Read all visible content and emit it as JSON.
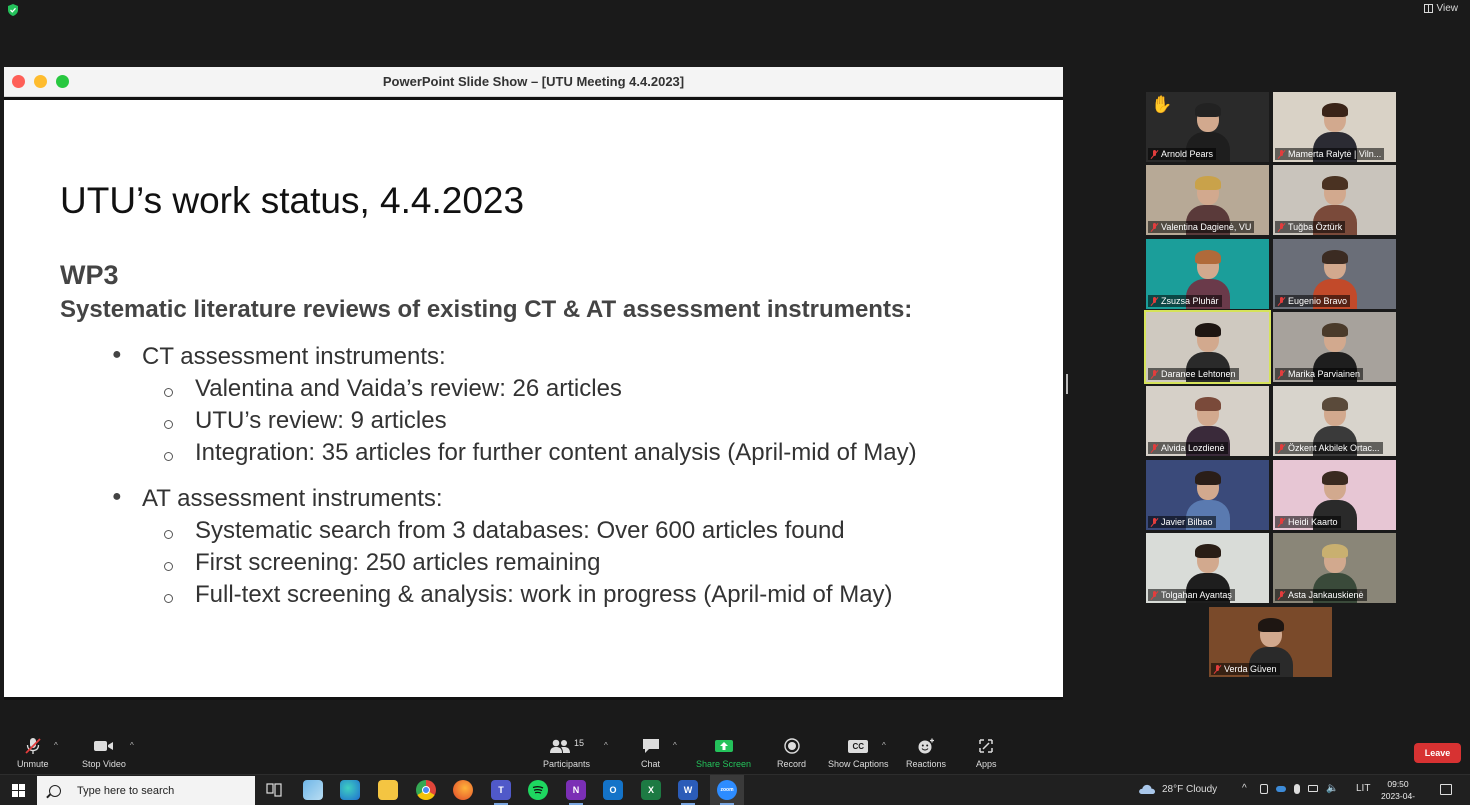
{
  "top": {
    "view_label": "View"
  },
  "window": {
    "title": "PowerPoint Slide Show – [UTU Meeting 4.4.2023]"
  },
  "slide": {
    "title": "UTU’s work status, 4.4.2023",
    "wp": "WP3",
    "subtitle": "Systematic literature reviews of existing CT & AT assessment instruments:",
    "bullets": [
      {
        "text": "CT assessment instruments:",
        "sub": [
          "Valentina and Vaida’s review: 26 articles",
          "UTU’s review: 9 articles",
          "Integration: 35 articles for further content analysis (April-mid of May)"
        ]
      },
      {
        "text": "AT assessment instruments:",
        "sub": [
          "Systematic search from 3 databases: Over 600 articles found",
          "First screening: 250 articles remaining",
          "Full-text screening & analysis: work in progress (April-mid of May)"
        ]
      }
    ]
  },
  "participants": [
    {
      "name": "Arnold Pears",
      "bg": "#2a2a2a",
      "hair": "#222",
      "body": "#1e1e1e",
      "hand": "✋"
    },
    {
      "name": "Mamerta Ralytė | Viln...",
      "bg": "#d9d2c6",
      "hair": "#3a2418",
      "body": "#2b2b33"
    },
    {
      "name": "Valentina Dagienė, VU",
      "bg": "#b7a996",
      "hair": "#c9a24a",
      "body": "#5a3a3a"
    },
    {
      "name": "Tuğba Öztürk",
      "bg": "#c9c4bc",
      "hair": "#4a3222",
      "body": "#7a4a3a"
    },
    {
      "name": "Zsuzsa Pluhár",
      "bg": "#1b9e9a",
      "hair": "#b06a3a",
      "body": "#6a3a4a"
    },
    {
      "name": "Eugenio Bravo",
      "bg": "#6a6e78",
      "hair": "#3b2b22",
      "body": "#c24a2a"
    },
    {
      "name": "Daranee Lehtonen",
      "bg": "#cfc9c0",
      "hair": "#1e1612",
      "body": "#2a2a2a",
      "active": true
    },
    {
      "name": "Marika Parviainen",
      "bg": "#a7a29c",
      "hair": "#4a3a2a",
      "body": "#1e1e1e"
    },
    {
      "name": "Alvida Lozdienė",
      "bg": "#d6d0c8",
      "hair": "#7a4a3a",
      "body": "#3a2a3a"
    },
    {
      "name": "Özkent Akbilek Ortac...",
      "bg": "#d8d4cc",
      "hair": "#5a4a3a",
      "body": "#3a3a3a"
    },
    {
      "name": "Javier Bilbao",
      "bg": "#3a4a7a",
      "hair": "#2a1e18",
      "body": "#5a7ab0"
    },
    {
      "name": "Heidi Kaarto",
      "bg": "#e7c6d4",
      "hair": "#3a2a20",
      "body": "#2a2a2a"
    },
    {
      "name": "Tolgahan Ayantaş",
      "bg": "#d9dcd8",
      "hair": "#2a1e16",
      "body": "#1e1e1e"
    },
    {
      "name": "Asta Jankauskienė",
      "bg": "#8a8678",
      "hair": "#c9b070",
      "body": "#3a4a3a"
    },
    {
      "name": "Verda Güven",
      "bg": "#7a4a2a",
      "hair": "#1e1612",
      "body": "#2a2a2a"
    }
  ],
  "toolbar": {
    "unmute": "Unmute",
    "stop_video": "Stop Video",
    "participants": "Participants",
    "participants_count": "15",
    "chat": "Chat",
    "share_screen": "Share Screen",
    "record": "Record",
    "show_captions": "Show Captions",
    "captions_icon": "CC",
    "reactions": "Reactions",
    "apps": "Apps",
    "leave": "Leave"
  },
  "taskbar": {
    "search_placeholder": "Type here to search",
    "weather": "28°F  Cloudy",
    "lang": "LIT",
    "time": "09:50",
    "date": "2023-04-04",
    "zoom_label": "zoom"
  },
  "colors": {
    "accent_green": "#24c25b",
    "leave_red": "#d73232",
    "active_outline": "#d6e35a"
  }
}
